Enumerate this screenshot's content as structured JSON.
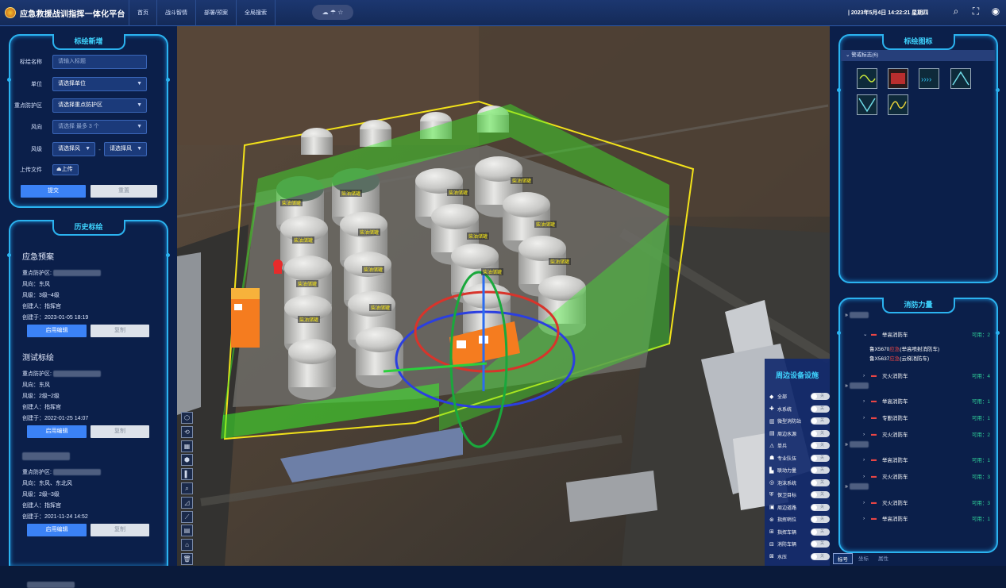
{
  "header": {
    "app_title": "应急救援战训指挥一体化平台",
    "nav": [
      "首页",
      "战斗智情",
      "部署/预案",
      "全局搜索"
    ],
    "weather_icons": "☁ ☂ ☆",
    "datetime": "| 2023年5月4日 14:22:21 星期四"
  },
  "left": {
    "form_title": "标绘新增",
    "form": {
      "name_label": "标绘名称",
      "name_placeholder": "请输入标题",
      "unit_label": "单位",
      "unit_value": "请选择单位",
      "zone_label": "重点防护区",
      "zone_value": "请选择重点防护区",
      "wind_dir_label": "风向",
      "wind_dir_value": "请选择 最多 3 个",
      "wind_level_label": "风级",
      "wind_level_a": "请选择风",
      "wind_level_sep": "-",
      "wind_level_b": "请选择风",
      "upload_label": "上传文件",
      "upload_button": "⏏上传",
      "submit": "提交",
      "reset": "重置"
    },
    "history_title": "历史标绘",
    "history": [
      {
        "title": "应急预案",
        "zone": "重点防护区:",
        "wind_dir": "风向：东风",
        "wind_level": "风级：3级~4级",
        "creator": "创建人：指挥官",
        "created": "创建于：2023-01-05 18:19",
        "edit": "启用编辑",
        "copy": "复制"
      },
      {
        "title": "测试标绘",
        "zone": "重点防护区:",
        "wind_dir": "风向：东风",
        "wind_level": "风级：2级~2级",
        "creator": "创建人：指挥官",
        "created": "创建于：2022-01-25 14:07",
        "edit": "启用编辑",
        "copy": "复制"
      },
      {
        "title": "",
        "zone": "重点防护区:",
        "wind_dir": "风向：东风、东北风",
        "wind_level": "风级：2级~3级",
        "creator": "创建人：指挥官",
        "created": "创建于：2021-11-24 14:52",
        "edit": "启用编辑",
        "copy": "复制"
      }
    ]
  },
  "scene": {
    "tank_labels": [
      "柴油储罐",
      "柴油储罐",
      "柴油储罐",
      "柴油储罐",
      "柴油储罐",
      "柴油储罐",
      "柴油储罐",
      "柴油储罐",
      "柴油储罐",
      "柴油储罐",
      "柴油储罐",
      "柴油储罐",
      "柴油储罐",
      "柴油储罐"
    ],
    "tools": [
      "⬡",
      "⟲",
      "▦",
      "⬢",
      "▌",
      "⌕",
      "◿",
      "⟋",
      "▤",
      "⌂",
      "🗑"
    ]
  },
  "periph": {
    "title": "周边设备设施",
    "items": [
      {
        "icon": "◆",
        "name": "全部",
        "state": "关"
      },
      {
        "icon": "✚",
        "name": "水系统",
        "state": "关"
      },
      {
        "icon": "▥",
        "name": "微型消防站",
        "state": "关"
      },
      {
        "icon": "▤",
        "name": "周边水源",
        "state": "关"
      },
      {
        "icon": "⚠",
        "name": "单兵",
        "state": "关"
      },
      {
        "icon": "☗",
        "name": "专业队伍",
        "state": "关"
      },
      {
        "icon": "▙",
        "name": "联动力量",
        "state": "关"
      },
      {
        "icon": "◎",
        "name": "泡沫系统",
        "state": "关"
      },
      {
        "icon": "⛨",
        "name": "保卫目标",
        "state": "关"
      },
      {
        "icon": "▣",
        "name": "周边道路",
        "state": "关"
      },
      {
        "icon": "⊛",
        "name": "指挥哨位",
        "state": "关"
      },
      {
        "icon": "⊞",
        "name": "指挥车辆",
        "state": "关"
      },
      {
        "icon": "⊟",
        "name": "消防车辆",
        "state": "关"
      },
      {
        "icon": "⊠",
        "name": "水压",
        "state": "关"
      }
    ]
  },
  "right": {
    "icon_title": "标绘图标",
    "icon_group": "警戒标志(6)",
    "force_title": "消防力量",
    "forces": [
      {
        "arrow": "›",
        "name": "举高消防车",
        "avail": "可用：2",
        "expanded": true
      },
      {
        "arrow": "›",
        "name": "灭火消防车",
        "avail": "可用：4",
        "expanded": false
      },
      {
        "arrow": "›",
        "name": "举高消防车",
        "avail": "可用：1",
        "expanded": false
      },
      {
        "arrow": "›",
        "name": "专勤消防车",
        "avail": "可用：1",
        "expanded": false
      },
      {
        "arrow": "›",
        "name": "灭火消防车",
        "avail": "可用：2",
        "expanded": false
      },
      {
        "arrow": "›",
        "name": "举高消防车",
        "avail": "可用：1",
        "expanded": false
      },
      {
        "arrow": "›",
        "name": "灭火消防车",
        "avail": "可用：3",
        "expanded": false
      },
      {
        "arrow": "›",
        "name": "灭火消防车",
        "avail": "可用：3",
        "expanded": false
      },
      {
        "arrow": "›",
        "name": "举高消防车",
        "avail": "可用：1",
        "expanded": false
      }
    ],
    "sub1": {
      "a": "鲁X5670应急",
      "b": "应急",
      "c": "(举高喷射消防车)"
    },
    "sub2": {
      "a": "鲁X5637应急",
      "b": "应急",
      "c": "(云梯消防车)"
    },
    "tabs": [
      "标号",
      "坐标",
      "属性"
    ]
  }
}
